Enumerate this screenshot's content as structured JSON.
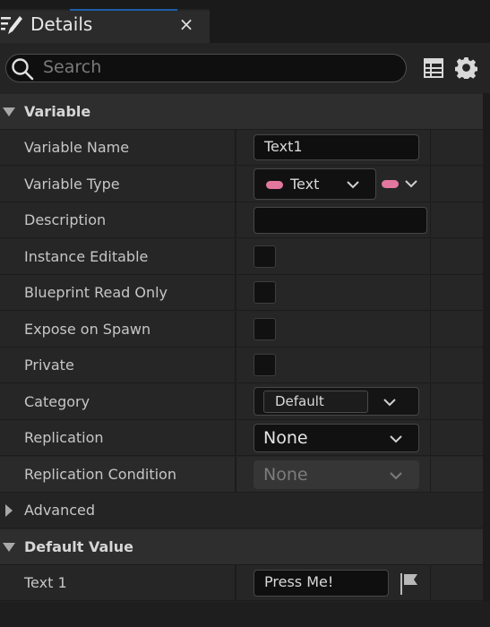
{
  "tab": {
    "title": "Details",
    "close": "×",
    "icon": "edit-icon"
  },
  "search": {
    "placeholder": "Search",
    "value": ""
  },
  "toolbar": {
    "grid_icon": "table-icon",
    "settings_icon": "gear-icon"
  },
  "sections": {
    "variable": "Variable",
    "advanced": "Advanced",
    "default_value": "Default Value"
  },
  "rows": {
    "variable_name": {
      "label": "Variable Name",
      "value": "Text1"
    },
    "variable_type": {
      "label": "Variable Type",
      "value": "Text"
    },
    "description": {
      "label": "Description",
      "value": ""
    },
    "instance_editable": {
      "label": "Instance Editable",
      "checked": false
    },
    "blueprint_read_only": {
      "label": "Blueprint Read Only",
      "checked": false
    },
    "expose_on_spawn": {
      "label": "Expose on Spawn",
      "checked": false
    },
    "private": {
      "label": "Private",
      "checked": false
    },
    "category": {
      "label": "Category",
      "value": "Default"
    },
    "replication": {
      "label": "Replication",
      "value": "None"
    },
    "replication_condition": {
      "label": "Replication Condition",
      "value": "None"
    },
    "text_1": {
      "label": "Text 1",
      "value": "Press Me!"
    }
  },
  "colors": {
    "pin_text": "#e4779e",
    "accent": "#1d5fa8"
  }
}
